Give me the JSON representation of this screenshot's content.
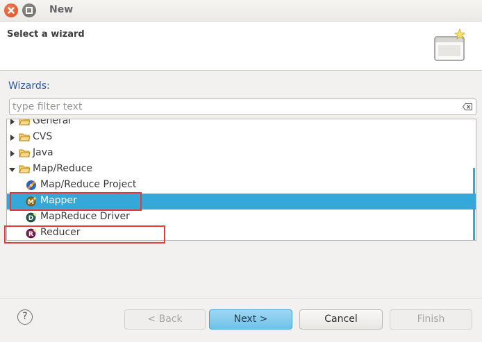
{
  "window": {
    "title": "New"
  },
  "header": {
    "title": "Select a wizard"
  },
  "wizards_label": "Wizards:",
  "filter": {
    "placeholder": "type filter text",
    "value": ""
  },
  "tree": {
    "items": [
      {
        "label": "General",
        "type": "folder",
        "expanded": false
      },
      {
        "label": "CVS",
        "type": "folder",
        "expanded": false
      },
      {
        "label": "Java",
        "type": "folder",
        "expanded": false
      },
      {
        "label": "Map/Reduce",
        "type": "folder",
        "expanded": true
      },
      {
        "label": "Map/Reduce Project",
        "type": "project-icon"
      },
      {
        "label": "Mapper",
        "type": "mapper-icon",
        "selected": true
      },
      {
        "label": "MapReduce Driver",
        "type": "driver-icon"
      },
      {
        "label": "Reducer",
        "type": "reducer-icon"
      }
    ]
  },
  "buttons": {
    "back": "< Back",
    "next": "Next >",
    "cancel": "Cancel",
    "finish": "Finish"
  },
  "colors": {
    "selection": "#35a7d8",
    "highlight_box": "#e23b3b",
    "link": "#2a5aa3"
  }
}
